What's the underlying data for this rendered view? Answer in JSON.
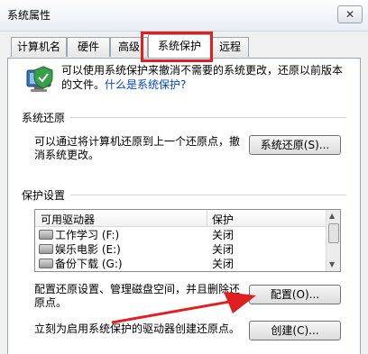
{
  "window": {
    "title": "系统属性",
    "close_glyph": "✕"
  },
  "tabs": [
    {
      "label": "计算机名"
    },
    {
      "label": "硬件"
    },
    {
      "label": "高级"
    },
    {
      "label": "系统保护",
      "active": true
    },
    {
      "label": "远程"
    }
  ],
  "intro": {
    "text": "可以使用系统保护来撤消不需要的系统更改，还原以前版本的文件。",
    "link": "什么是系统保护?",
    "icon": "computer-shield-icon"
  },
  "restore": {
    "title": "系统还原",
    "description": "可以通过将计算机还原到上一个还原点，撤消系统更改。",
    "button": "系统还原(S)..."
  },
  "protection": {
    "title": "保护设置",
    "columns": [
      "可用驱动器",
      "保护"
    ],
    "drives": [
      {
        "name": "工作学习",
        "letter": "(F:)",
        "status": "关闭"
      },
      {
        "name": "娱乐电影",
        "letter": "(E:)",
        "status": "关闭"
      },
      {
        "name": "备份下载",
        "letter": "(G:)",
        "status": "关闭"
      }
    ],
    "config_text": "配置还原设置、管理磁盘空间，并且删除还原点。",
    "config_button": "配置(O)...",
    "create_text": "立刻为启用系统保护的驱动器创建还原点。",
    "create_button": "创建(C)..."
  },
  "annotation": {
    "highlight_color": "#e02020",
    "arrow_color": "#e02020"
  }
}
